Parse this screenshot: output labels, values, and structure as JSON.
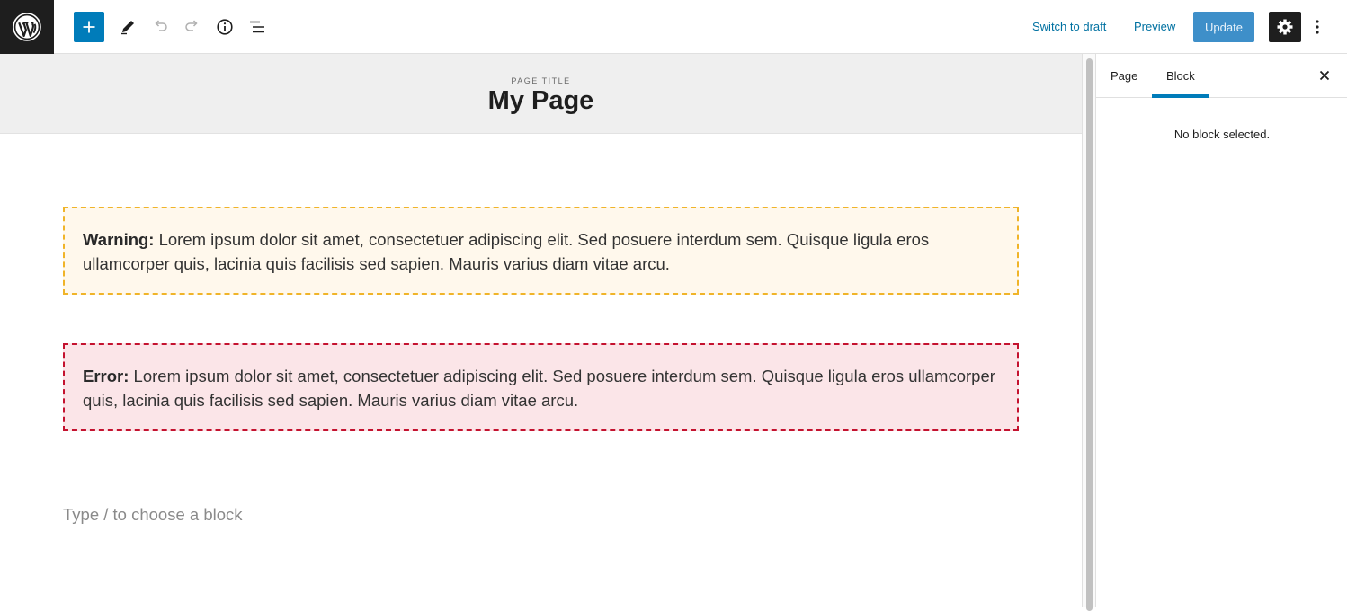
{
  "toolbar": {
    "add_block_icon": "plus-icon",
    "tools_icon": "pencil-icon",
    "undo_icon": "undo-icon",
    "redo_icon": "redo-icon",
    "details_icon": "info-icon",
    "list_view_icon": "list-view-icon",
    "switch_to_draft_label": "Switch to draft",
    "preview_label": "Preview",
    "update_label": "Update",
    "settings_icon": "gear-icon",
    "more_icon": "more-vertical-icon",
    "accent": "#007cba"
  },
  "editor": {
    "page_title_label": "PAGE TITLE",
    "page_title": "My Page",
    "warning": {
      "label": "Warning:",
      "text": " Lorem ipsum dolor sit amet, consectetuer adipiscing elit. Sed posuere interdum sem. Quisque ligula eros ullamcorper quis, lacinia quis facilisis sed sapien. Mauris varius diam vitae arcu.",
      "border_color": "#f0b429",
      "background": "#fff8ec"
    },
    "error": {
      "label": "Error:",
      "text": " Lorem ipsum dolor sit amet, consectetuer adipiscing elit. Sed posuere interdum sem. Quisque ligula eros ullamcorper quis, lacinia quis facilisis sed sapien. Mauris varius diam vitae arcu.",
      "border_color": "#c4122f",
      "background": "#fbe5e8"
    },
    "block_placeholder": "Type / to choose a block"
  },
  "sidebar": {
    "tabs": [
      {
        "label": "Page",
        "active": false
      },
      {
        "label": "Block",
        "active": true
      }
    ],
    "close_icon": "close-icon",
    "empty_message": "No block selected."
  }
}
